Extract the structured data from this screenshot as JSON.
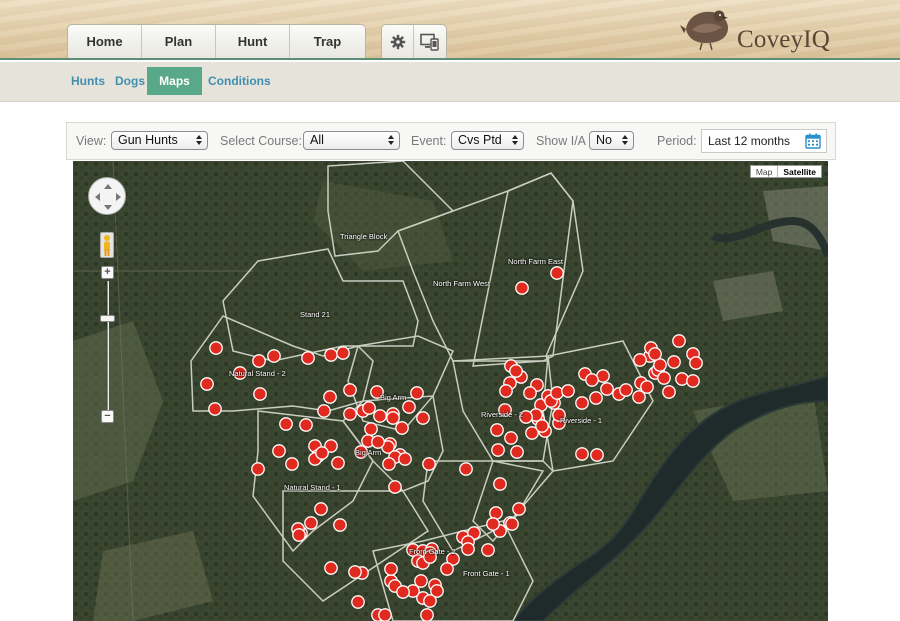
{
  "header": {
    "nav": [
      "Home",
      "Plan",
      "Hunt",
      "Trap"
    ],
    "icons": [
      "gear-icon",
      "devices-icon"
    ],
    "logo_text": "CoveyIQ"
  },
  "subnav": {
    "items": [
      "Hunts",
      "Dogs",
      "Maps",
      "Conditions"
    ],
    "active": "Maps"
  },
  "filters": {
    "view_label": "View:",
    "view_value": "Gun Hunts",
    "course_label": "Select Course:",
    "course_value": "All",
    "event_label": "Event:",
    "event_value": "Cvs Ptd",
    "show_label": "Show I/A",
    "show_value": "No",
    "period_label": "Period:",
    "period_value": "Last 12 months",
    "period_icon": "calendar-icon"
  },
  "map": {
    "type_options": [
      "Map",
      "Satellite"
    ],
    "selected_type": "Satellite",
    "zoom_in": "+",
    "zoom_out": "−",
    "marker_color": "#e02a20",
    "course_labels": [
      "Triangle Block",
      "North Farm East",
      "North Farm West",
      "Stand 21",
      "Natural Stand - 2",
      "Big Arm",
      "Riverside - 2",
      "Riverside - 1",
      "Big Arm",
      "Natural Stand - 1",
      "Front Gate - 2",
      "Front Gate - 1"
    ]
  }
}
